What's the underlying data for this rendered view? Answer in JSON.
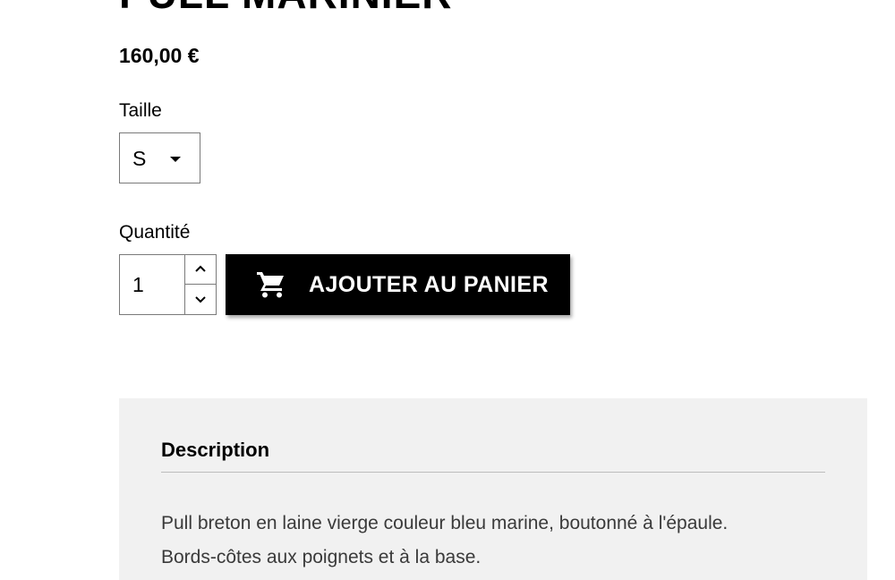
{
  "product": {
    "title": "PULL MARINIER",
    "price": "160,00 €"
  },
  "size": {
    "label": "Taille",
    "selected": "S"
  },
  "quantity": {
    "label": "Quantité",
    "value": "1"
  },
  "actions": {
    "add_to_cart": "AJOUTER AU PANIER"
  },
  "description": {
    "heading": "Description",
    "line1": "Pull breton en laine vierge couleur bleu marine, boutonné à l'épaule.",
    "line2": "Bords-côtes aux poignets et à la base."
  },
  "colors": {
    "button_bg": "#000000",
    "panel_bg": "#f1f1f1"
  }
}
